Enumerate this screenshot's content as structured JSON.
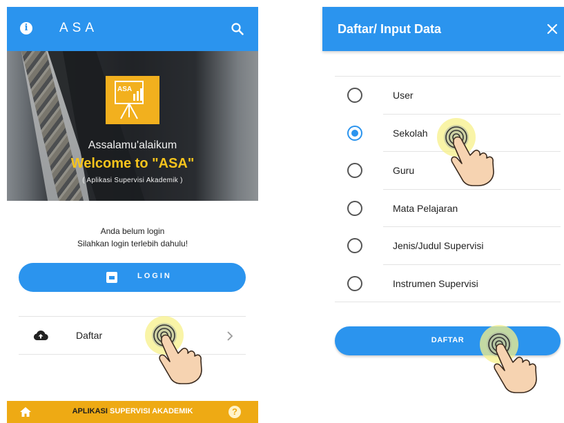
{
  "left_screen": {
    "appbar": {
      "title": "ASA",
      "info_icon": "info-icon",
      "search_icon": "search-icon"
    },
    "hero": {
      "logo_text": "ASA",
      "greeting": "Assalamu'alaikum",
      "welcome": "Welcome to \"ASA\"",
      "subtitle": "( Aplikasi Supervisi Akademik )"
    },
    "message": {
      "line1": "Anda belum login",
      "line2": "Silahkan login terlebih dahulu!"
    },
    "login_button": {
      "label": "LOGIN",
      "icon": "login-icon"
    },
    "daftar_row": {
      "label": "Daftar",
      "icon": "cloud-upload-icon",
      "chevron": "chevron-right-icon"
    },
    "footer": {
      "prefix": "APLIKASI",
      "highlight": "SUPERVISI AKADEMIK",
      "home_icon": "home-icon",
      "help_icon": "help-icon",
      "help_glyph": "?"
    }
  },
  "right_screen": {
    "header": {
      "title": "Daftar/ Input Data",
      "close_icon": "close-icon"
    },
    "options": [
      {
        "label": "User",
        "selected": false
      },
      {
        "label": "Sekolah",
        "selected": true
      },
      {
        "label": "Guru",
        "selected": false
      },
      {
        "label": "Mata Pelajaran",
        "selected": false
      },
      {
        "label": "Jenis/Judul Supervisi",
        "selected": false
      },
      {
        "label": "Instrumen Supervisi",
        "selected": false
      }
    ],
    "submit_button": {
      "label": "DAFTAR"
    }
  },
  "colors": {
    "primary": "#2b94ee",
    "footer": "#eeaa14",
    "welcome": "#f7c41c",
    "tap_ring": "#f7f08a"
  }
}
